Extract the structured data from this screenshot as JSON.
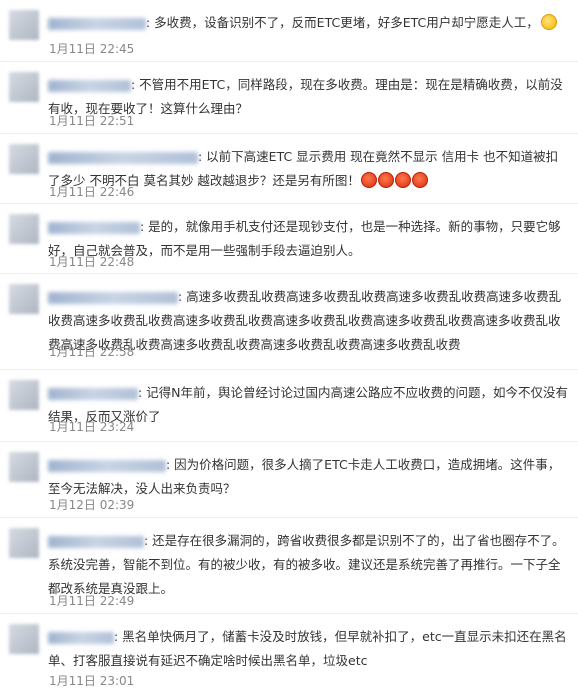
{
  "comments": [
    {
      "text": ": 多收费，设备识别不了，反而ETC更堵，好多ETC用户却宁愿走人工，",
      "time": "1月11日 22:45",
      "emoji": "shy-face-icon"
    },
    {
      "text": ": 不管用不用ETC，同样路段，现在多收费。理由是：现在是精确收费，以前没有收，现在要收了！这算什么理由？",
      "time": "1月11日 22:51"
    },
    {
      "text": ": 以前下高速ETC 显示费用 现在竟然不显示 信用卡 也不知道被扣了多少 不明不白 莫名其妙 越改越退步？还是另有所图！",
      "time": "1月11日 22:46",
      "emoji": "angry-face-icon"
    },
    {
      "text": ": 是的，就像用手机支付还是现钞支付，也是一种选择。新的事物，只要它够好，自己就会普及，而不是用一些强制手段去逼迫别人。",
      "time": "1月11日 22:48"
    },
    {
      "text": ": 高速多收费乱收费高速多收费乱收费高速多收费乱收费高速多收费乱收费高速多收费乱收费高速多收费乱收费高速多收费乱收费高速多收费乱收费高速多收费乱收费高速多收费乱收费高速多收费乱收费高速多收费乱收费高速多收费乱收费",
      "time": "1月11日 22:58"
    },
    {
      "text": ": 记得N年前，舆论曾经讨论过国内高速公路应不应收费的问题，如今不仅没有结果，反而又涨价了",
      "time": "1月11日 23:24"
    },
    {
      "text": ": 因为价格问题，很多人摘了ETC卡走人工收费口，造成拥堵。这件事，至今无法解决，没人出来负责吗？",
      "time": "1月12日 02:39"
    },
    {
      "text": ": 还是存在很多漏洞的，跨省收费很多都是识别不了的，出了省也圈存不了。系统没完善，智能不到位。有的被少收，有的被多收。建议还是系统完善了再推行。一下子全都改系统是真没跟上。",
      "time": "1月11日 22:49"
    },
    {
      "text": ": 黑名单快俩月了，储蓄卡没及时放钱，但早就补扣了，etc一直显示未扣还在黑名单、打客服直接说有延迟不确定啥时候出黑名单，垃圾etc",
      "time": "1月11日 23:01"
    }
  ]
}
